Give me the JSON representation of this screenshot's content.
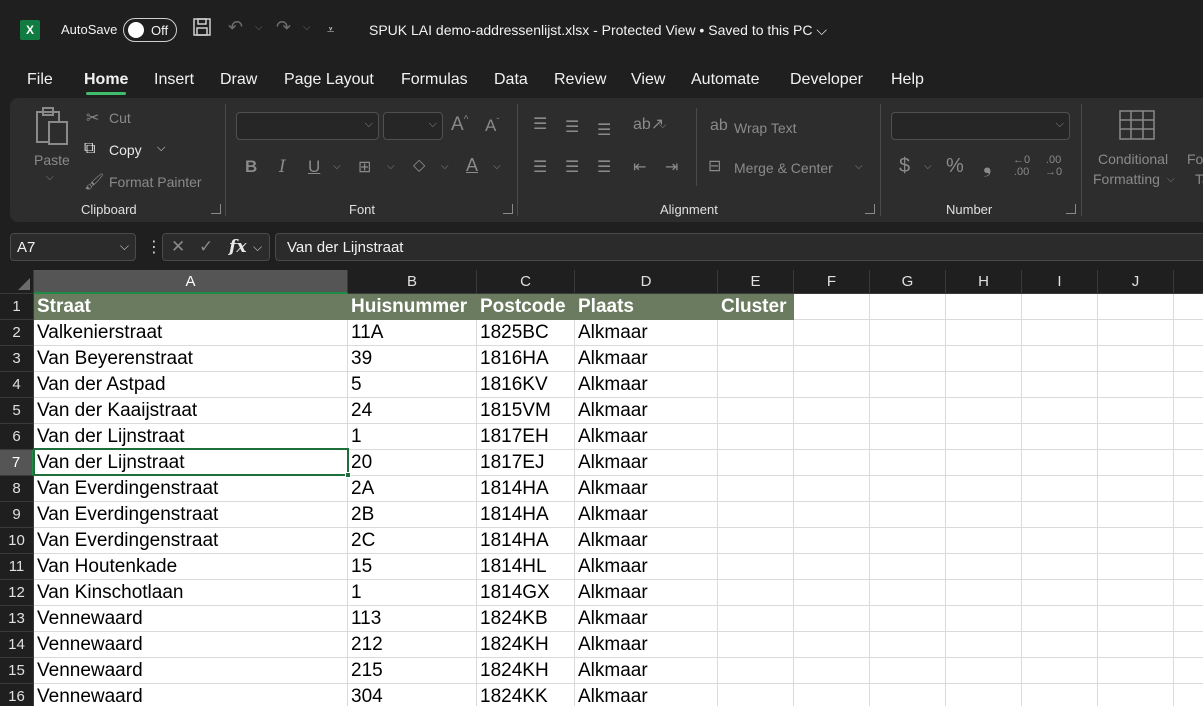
{
  "titlebar": {
    "autosave_label": "AutoSave",
    "autosave_state": "Off",
    "document_title": "SPUK LAI demo-addressenlijst.xlsx  -  Protected View • Saved to this PC",
    "title_chevron": "⌵",
    "icons": [
      "excel-logo-icon",
      "save-icon",
      "undo-icon",
      "redo-icon",
      "customize-qat-icon"
    ]
  },
  "menu": {
    "items": [
      "File",
      "Home",
      "Insert",
      "Draw",
      "Page Layout",
      "Formulas",
      "Data",
      "Review",
      "View",
      "Automate",
      "Developer",
      "Help"
    ],
    "active": "Home",
    "accent": "#3fbd6b"
  },
  "ribbon": {
    "clipboard": {
      "label": "Clipboard",
      "paste": "Paste",
      "cut": "Cut",
      "copy": "Copy",
      "format_painter": "Format Painter"
    },
    "font": {
      "label": "Font",
      "bold": "B",
      "italic": "I",
      "underline": "U",
      "grow": "A",
      "shrink": "A",
      "font_color": "A"
    },
    "alignment": {
      "label": "Alignment",
      "wrap_text": "Wrap Text",
      "merge_center": "Merge & Center"
    },
    "number": {
      "label": "Number",
      "currency": "$",
      "percent": "%",
      "comma": "❟",
      "increase_decimal_top": "←0",
      "increase_decimal_bottom": ".00",
      "decrease_decimal_top": ".00",
      "decrease_decimal_bottom": "→0"
    },
    "styles": {
      "conditional_line1": "Conditional",
      "conditional_line2": "Formatting",
      "format_table_line1": "Fo",
      "format_table_line2": "Ta"
    }
  },
  "formula_bar": {
    "name_box": "A7",
    "fx": "fx",
    "value": "Van der Lijnstraat"
  },
  "sheet": {
    "columns": [
      "A",
      "B",
      "C",
      "D",
      "E",
      "F",
      "G",
      "H",
      "I",
      "J"
    ],
    "selected_column": "A",
    "selected_row": "7",
    "header_fill": "#6a7b5f",
    "headers": [
      "Straat",
      "Huisnummer",
      "Postcode",
      "Plaats",
      "Cluster"
    ],
    "rows": [
      {
        "n": "1",
        "cells": [
          "Straat",
          "Huisnummer",
          "Postcode",
          "Plaats",
          "Cluster"
        ]
      },
      {
        "n": "2",
        "cells": [
          "Valkenierstraat",
          "11A",
          "1825BC",
          "Alkmaar",
          ""
        ]
      },
      {
        "n": "3",
        "cells": [
          "Van Beyerenstraat",
          "39",
          "1816HA",
          "Alkmaar",
          ""
        ]
      },
      {
        "n": "4",
        "cells": [
          "Van der Astpad",
          "5",
          "1816KV",
          "Alkmaar",
          ""
        ]
      },
      {
        "n": "5",
        "cells": [
          "Van der Kaaijstraat",
          "24",
          "1815VM",
          "Alkmaar",
          ""
        ]
      },
      {
        "n": "6",
        "cells": [
          "Van der Lijnstraat",
          "1",
          "1817EH",
          "Alkmaar",
          ""
        ]
      },
      {
        "n": "7",
        "cells": [
          "Van der Lijnstraat",
          "20",
          "1817EJ",
          "Alkmaar",
          ""
        ]
      },
      {
        "n": "8",
        "cells": [
          "Van Everdingenstraat",
          "2A",
          "1814HA",
          "Alkmaar",
          ""
        ]
      },
      {
        "n": "9",
        "cells": [
          "Van Everdingenstraat",
          "2B",
          "1814HA",
          "Alkmaar",
          ""
        ]
      },
      {
        "n": "10",
        "cells": [
          "Van Everdingenstraat",
          "2C",
          "1814HA",
          "Alkmaar",
          ""
        ]
      },
      {
        "n": "11",
        "cells": [
          "Van Houtenkade",
          "15",
          "1814HL",
          "Alkmaar",
          ""
        ]
      },
      {
        "n": "12",
        "cells": [
          "Van Kinschotlaan",
          "1",
          "1814GX",
          "Alkmaar",
          ""
        ]
      },
      {
        "n": "13",
        "cells": [
          "Vennewaard",
          "113",
          "1824KB",
          "Alkmaar",
          ""
        ]
      },
      {
        "n": "14",
        "cells": [
          "Vennewaard",
          "212",
          "1824KH",
          "Alkmaar",
          ""
        ]
      },
      {
        "n": "15",
        "cells": [
          "Vennewaard",
          "215",
          "1824KH",
          "Alkmaar",
          ""
        ]
      },
      {
        "n": "16",
        "cells": [
          "Vennewaard",
          "304",
          "1824KK",
          "Alkmaar",
          ""
        ]
      }
    ]
  }
}
